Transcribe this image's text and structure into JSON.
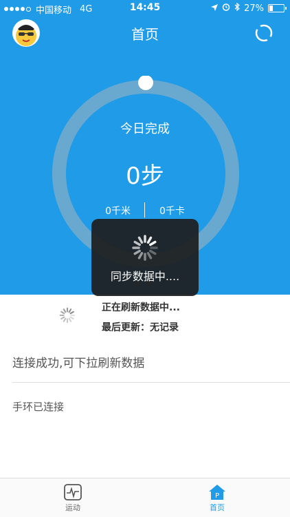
{
  "status_bar": {
    "carrier": "中国移动",
    "network": "4G",
    "time": "14:45",
    "battery": "27%",
    "battery_level": 0.27,
    "icons": [
      "location-arrow-icon",
      "alarm-icon",
      "bluetooth-icon"
    ]
  },
  "header": {
    "title": "首页",
    "avatar": "cartoon-avatar",
    "right_icon": "watch-icon"
  },
  "ring": {
    "label": "今日完成",
    "steps": "0步",
    "distance": "0千米",
    "calories": "0千卡",
    "progress": 0
  },
  "toast": {
    "message": "同步数据中...."
  },
  "refresh": {
    "status": "正在刷新数据中...",
    "last_update": "最后更新：无记录"
  },
  "messages": {
    "connection": "连接成功,可下拉刷新数据",
    "band": "手环已连接"
  },
  "tabs": [
    {
      "label": "运动",
      "icon": "activity-chart-icon",
      "active": false
    },
    {
      "label": "首页",
      "icon": "home-icon",
      "active": true
    }
  ],
  "colors": {
    "primary": "#1f9be8",
    "ring_track": "#6aa9cf",
    "toast_bg": "#1e1e1e"
  }
}
